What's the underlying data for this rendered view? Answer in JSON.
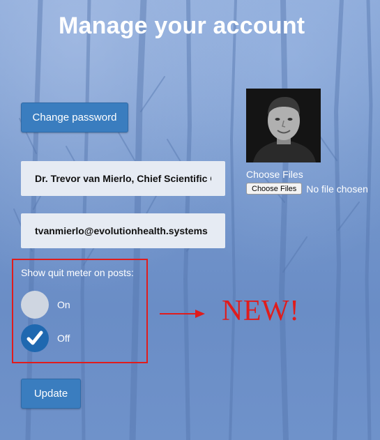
{
  "page": {
    "title": "Manage your account"
  },
  "account": {
    "change_password_label": "Change password",
    "name_value": "Dr. Trevor van Mierlo, Chief Scientific Of",
    "email_value": "tvanmierlo@evolutionhealth.systems",
    "update_label": "Update"
  },
  "photo": {
    "choose_files_label": "Choose Files",
    "file_button_label": "Choose Files",
    "file_status": "No file chosen"
  },
  "quit_meter": {
    "label": "Show quit meter on posts:",
    "options": [
      {
        "label": "On",
        "selected": false
      },
      {
        "label": "Off",
        "selected": true
      }
    ]
  },
  "annotation": {
    "text": "NEW!",
    "color": "#e01c1c"
  },
  "colors": {
    "button": "#3a7dbf",
    "radio_selected": "#1f68b0",
    "radio_unselected": "#cfd6e1",
    "annotation_red": "#e01c1c"
  }
}
